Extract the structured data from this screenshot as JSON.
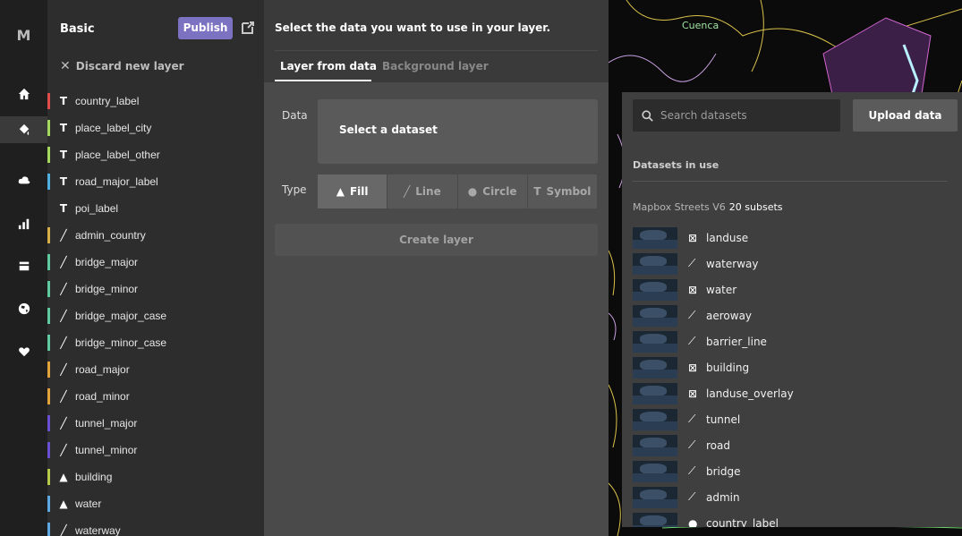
{
  "app": {
    "logo_letter": "M"
  },
  "rail": {
    "items": [
      {
        "icon": "home-icon"
      },
      {
        "icon": "paint-bucket-icon",
        "active": true
      },
      {
        "icon": "cloud-icon"
      },
      {
        "icon": "bar-chart-icon"
      },
      {
        "icon": "tray-icon"
      },
      {
        "icon": "globe-icon"
      },
      {
        "icon": "heart-icon"
      }
    ]
  },
  "layers_panel": {
    "style_name": "Basic",
    "publish_label": "Publish",
    "discard_label": "Discard new layer",
    "items": [
      {
        "label": "country_label",
        "type": "symbol",
        "color": "#e04b4b"
      },
      {
        "label": "place_label_city",
        "type": "symbol",
        "color": "#a3d95c"
      },
      {
        "label": "place_label_other",
        "type": "symbol",
        "color": "#a3d95c"
      },
      {
        "label": "road_major_label",
        "type": "symbol",
        "color": "#4fb0e0"
      },
      {
        "label": "poi_label",
        "type": "symbol",
        "color": "#2d2d2d"
      },
      {
        "label": "admin_country",
        "type": "line",
        "color": "#d8b04a"
      },
      {
        "label": "bridge_major",
        "type": "line",
        "color": "#5fc9a0"
      },
      {
        "label": "bridge_minor",
        "type": "line",
        "color": "#5fc9a0"
      },
      {
        "label": "bridge_major_case",
        "type": "line",
        "color": "#5fc9a0"
      },
      {
        "label": "bridge_minor_case",
        "type": "line",
        "color": "#5fc9a0"
      },
      {
        "label": "road_major",
        "type": "line",
        "color": "#e0a23a"
      },
      {
        "label": "road_minor",
        "type": "line",
        "color": "#e0a23a"
      },
      {
        "label": "tunnel_major",
        "type": "line",
        "color": "#6a4fd0"
      },
      {
        "label": "tunnel_minor",
        "type": "line",
        "color": "#6a4fd0"
      },
      {
        "label": "building",
        "type": "fill",
        "color": "#b7c94a"
      },
      {
        "label": "water",
        "type": "fill",
        "color": "#5da8e0"
      },
      {
        "label": "waterway",
        "type": "line",
        "color": "#5da8e0"
      }
    ]
  },
  "editor": {
    "instruction": "Select the data you want to use in your layer.",
    "tabs": {
      "active": "Layer from data",
      "inactive": "Background layer"
    },
    "data_label": "Data",
    "dataset_placeholder": "Select a dataset",
    "type_label": "Type",
    "types": [
      {
        "label": "Fill",
        "glyph": "▲",
        "active": true
      },
      {
        "label": "Line",
        "glyph": "╱",
        "active": false
      },
      {
        "label": "Circle",
        "glyph": "●",
        "active": false
      },
      {
        "label": "Symbol",
        "glyph": "T",
        "active": false
      }
    ],
    "create_label": "Create layer"
  },
  "map": {
    "city_label": "Cuenca"
  },
  "datasets_panel": {
    "search_placeholder": "Search datasets",
    "upload_label": "Upload data",
    "section_title": "Datasets in use",
    "source_name": "Mapbox Streets V6",
    "source_count": "20 subsets",
    "items": [
      {
        "name": "landuse",
        "glyph": "⊠"
      },
      {
        "name": "waterway",
        "glyph": "⟋"
      },
      {
        "name": "water",
        "glyph": "⊠"
      },
      {
        "name": "aeroway",
        "glyph": "⟋"
      },
      {
        "name": "barrier_line",
        "glyph": "⟋"
      },
      {
        "name": "building",
        "glyph": "⊠"
      },
      {
        "name": "landuse_overlay",
        "glyph": "⊠"
      },
      {
        "name": "tunnel",
        "glyph": "⟋"
      },
      {
        "name": "road",
        "glyph": "⟋"
      },
      {
        "name": "bridge",
        "glyph": "⟋"
      },
      {
        "name": "admin",
        "glyph": "⟋"
      },
      {
        "name": "country_label",
        "glyph": "●"
      }
    ]
  }
}
